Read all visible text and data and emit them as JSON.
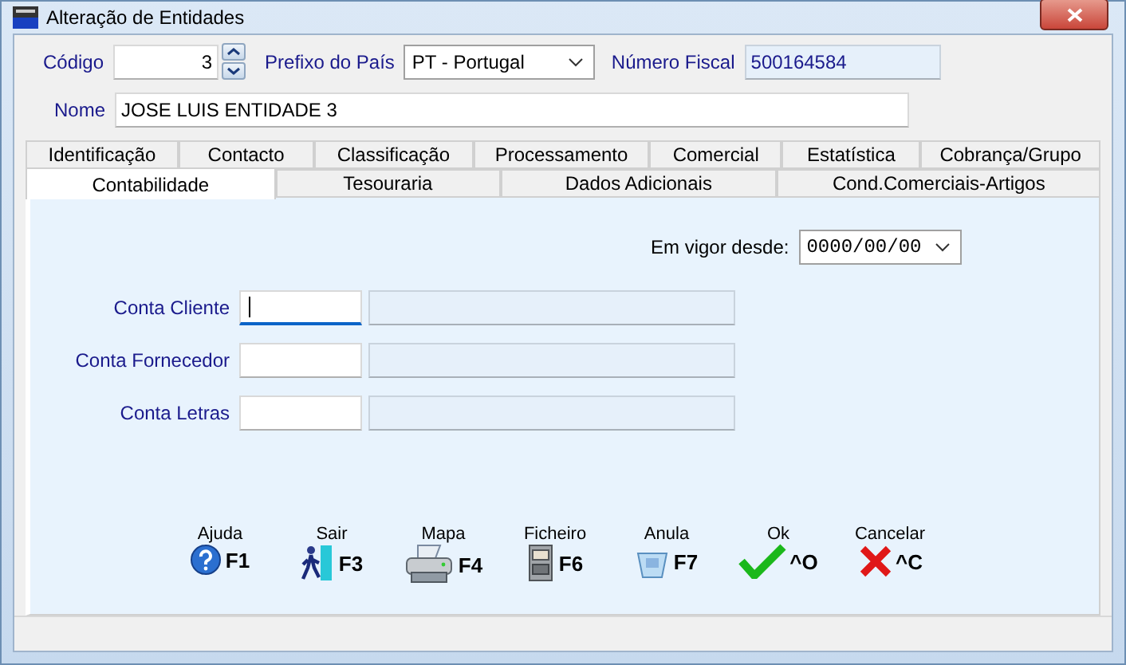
{
  "window": {
    "title": "Alteração de Entidades"
  },
  "header": {
    "code_label": "Código",
    "code": "3",
    "prefix_label": "Prefixo do País",
    "prefix": "PT - Portugal",
    "tax_label": "Número Fiscal",
    "tax": "500164584",
    "name_label": "Nome",
    "name": "JOSE LUIS ENTIDADE 3"
  },
  "tab_rows": [
    [
      {
        "label": "Identificação",
        "selected": false
      },
      {
        "label": "Contacto",
        "selected": false
      },
      {
        "label": "Classificação",
        "selected": false
      },
      {
        "label": "Processamento",
        "selected": false
      },
      {
        "label": "Comercial",
        "selected": false
      },
      {
        "label": "Estatística",
        "selected": false
      },
      {
        "label": "Cobrança/Grupo",
        "selected": false
      }
    ],
    [
      {
        "label": "Contabilidade",
        "selected": true
      },
      {
        "label": "Tesouraria",
        "selected": false
      },
      {
        "label": "Dados Adicionais",
        "selected": false
      },
      {
        "label": "Cond.Comerciais-Artigos",
        "selected": false
      }
    ]
  ],
  "valid_from": {
    "label": "Em vigor desde:",
    "value": "0000/00/00"
  },
  "accounts": [
    {
      "label": "Conta Cliente",
      "focused": true
    },
    {
      "label": "Conta Fornecedor",
      "focused": false
    },
    {
      "label": "Conta Letras",
      "focused": false
    }
  ],
  "buttons": [
    {
      "kind": "help",
      "label": "Ajuda",
      "key": "F1"
    },
    {
      "kind": "exit",
      "label": "Sair",
      "key": "F3"
    },
    {
      "kind": "print",
      "label": "Mapa",
      "key": "F4"
    },
    {
      "kind": "file",
      "label": "Ficheiro",
      "key": "F6"
    },
    {
      "kind": "undo",
      "label": "Anula",
      "key": "F7"
    },
    {
      "kind": "ok",
      "label": "Ok",
      "key": "^O"
    },
    {
      "kind": "cancel",
      "label": "Cancelar",
      "key": "^C"
    }
  ]
}
